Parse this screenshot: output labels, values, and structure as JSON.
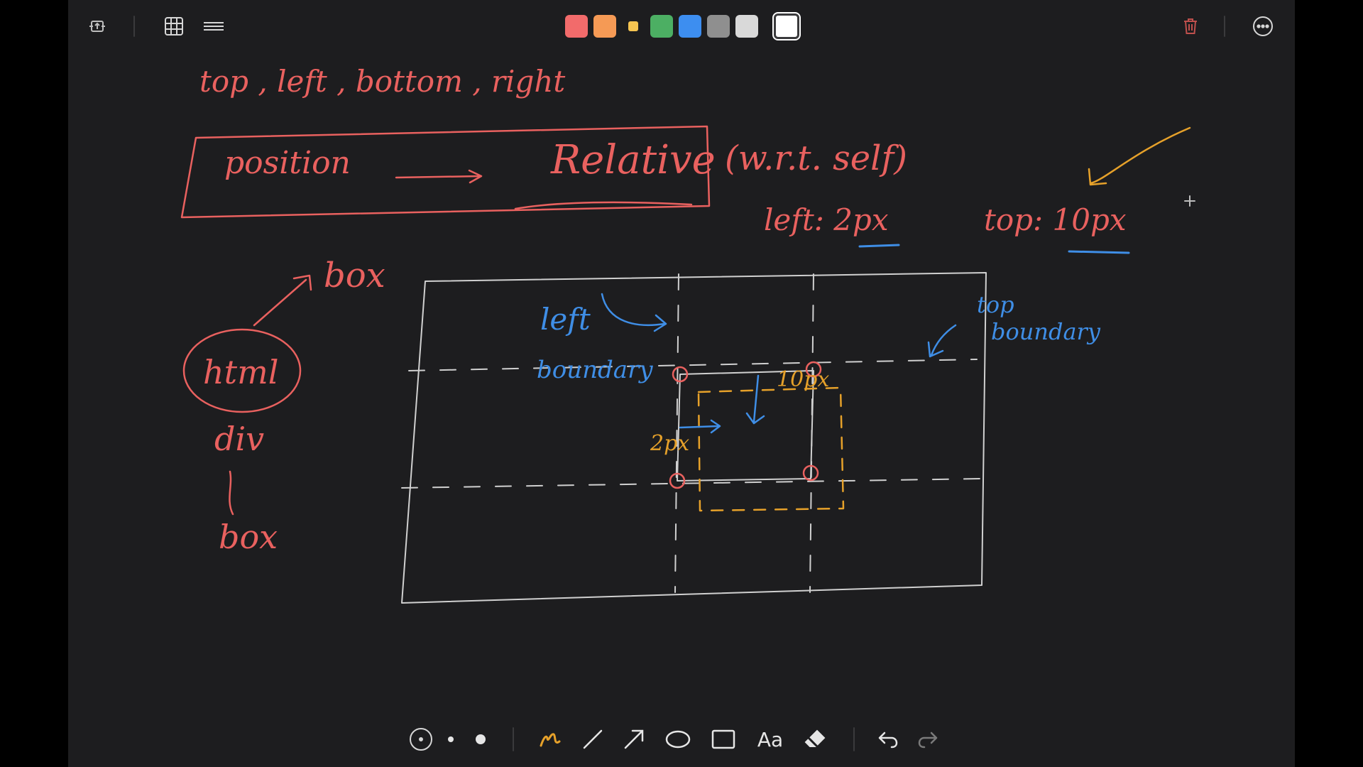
{
  "toolbar": {
    "left_icons": [
      "screen-share-icon",
      "grid-icon",
      "menu-icon"
    ],
    "swatches": [
      {
        "name": "red",
        "color": "#f26b6b"
      },
      {
        "name": "orange",
        "color": "#f59a55"
      },
      {
        "name": "yellow",
        "color": "#f5c451"
      },
      {
        "name": "green",
        "color": "#4caf63"
      },
      {
        "name": "blue",
        "color": "#3d8ef0"
      },
      {
        "name": "gray",
        "color": "#8f8f8f"
      },
      {
        "name": "light-gray",
        "color": "#d9d9d9"
      },
      {
        "name": "white",
        "color": "#ffffff"
      }
    ],
    "right_icons": [
      "trash-icon",
      "more-icon"
    ]
  },
  "colors": {
    "background": "#1d1d1f",
    "ink_red": "#e9615f",
    "ink_blue": "#3f8ee6",
    "ink_yellow": "#e6a12a",
    "ink_white": "#d0d0d0"
  },
  "notes": {
    "title_line": "top , left , bottom , right",
    "position": "position",
    "relative": "Relative",
    "wrt": "(w.r.t.   self)",
    "left_val": "left: 2px",
    "top_val": "top: 10px",
    "box_top": "box",
    "html": "html",
    "div": "div",
    "box_bottom": "box",
    "left_boundary_1": "left",
    "left_boundary_2": "boundary",
    "top_boundary_1": "top",
    "top_boundary_2": "boundary",
    "ten_px": "10px",
    "two_px": "2px"
  },
  "bottom_tools": {
    "tools": [
      "pen-size-thin-icon",
      "pen-size-medium-icon",
      "pen-size-large-icon",
      "pen-icon",
      "line-icon",
      "arrow-icon",
      "ellipse-icon",
      "rectangle-icon",
      "text-tool",
      "eraser-icon",
      "undo-icon",
      "redo-icon"
    ],
    "text_tool_label": "Aa"
  }
}
